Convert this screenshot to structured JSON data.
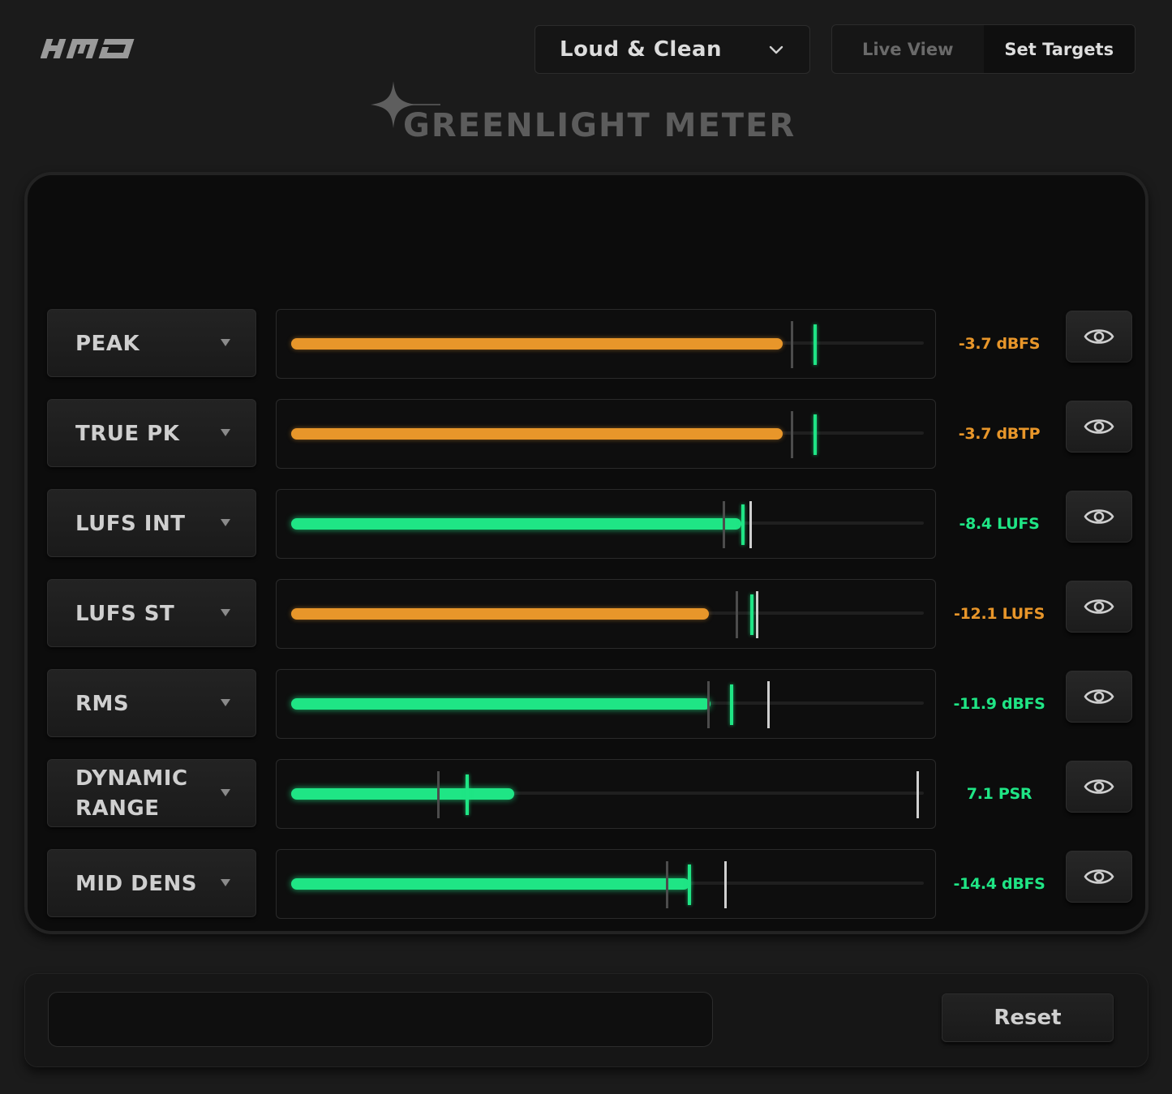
{
  "header": {
    "logo_text": "HMD",
    "preset": {
      "selected": "Loud & Clean"
    },
    "view_toggle": {
      "live_view_label": "Live View",
      "set_targets_label": "Set Targets",
      "active": "Set Targets"
    },
    "title": "GREENLIGHT METER"
  },
  "colors": {
    "orange": "#e8962a",
    "green": "#1fe585",
    "background": "#1b1b1b",
    "panel": "#0c0c0c"
  },
  "meters": [
    {
      "label": "PEAK",
      "readout": "-3.7 dBFS",
      "status": "orange",
      "level": 0.777,
      "marker_gray": 0.79,
      "marker_green": 0.825
    },
    {
      "label": "TRUE PK",
      "readout": "-3.7 dBTP",
      "status": "orange",
      "level": 0.777,
      "marker_gray": 0.79,
      "marker_green": 0.825
    },
    {
      "label": "LUFS INT",
      "readout": "-8.4 LUFS",
      "status": "green",
      "level": 0.712,
      "marker_gray": 0.682,
      "marker_green": 0.712,
      "marker_white": 0.724
    },
    {
      "label": "LUFS ST",
      "readout": "-12.1 LUFS",
      "status": "orange",
      "level": 0.66,
      "marker_gray": 0.703,
      "marker_green": 0.726,
      "marker_white": 0.734
    },
    {
      "label": "RMS",
      "readout": "-11.9 dBFS",
      "status": "green",
      "level": 0.663,
      "marker_gray": 0.658,
      "marker_green": 0.693,
      "marker_white": 0.753
    },
    {
      "label": "DYNAMIC RANGE",
      "readout": "7.1 PSR",
      "status": "green",
      "level": 0.353,
      "marker_gray": 0.231,
      "marker_green": 0.276,
      "marker_white": 0.988
    },
    {
      "label": "MID DENS",
      "readout": "-14.4 dBFS",
      "status": "green",
      "level": 0.629,
      "marker_gray": 0.592,
      "marker_green": 0.627,
      "marker_white": 0.684
    }
  ],
  "footer": {
    "message": "",
    "reset_label": "Reset"
  }
}
